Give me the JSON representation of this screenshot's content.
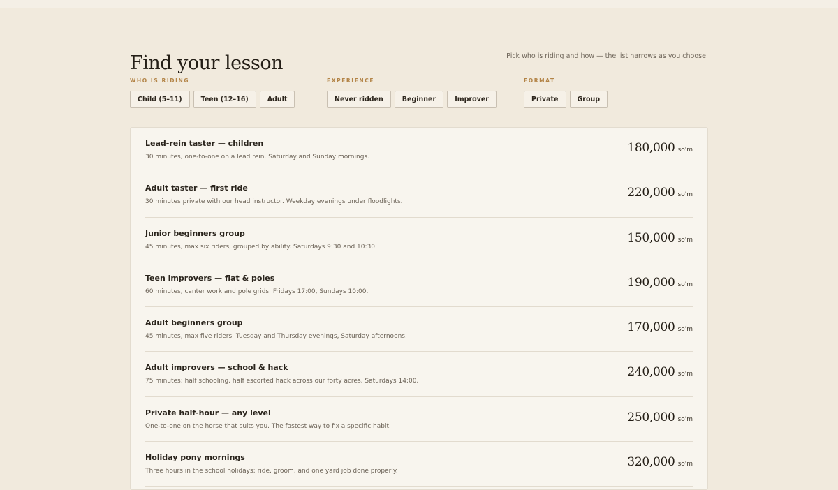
{
  "page": {
    "title": "Find your lesson",
    "hint": "Pick who is riding and how — the list narrows as you choose."
  },
  "filters": [
    {
      "label": "WHO IS RIDING",
      "options": [
        "Child (5–11)",
        "Teen (12–16)",
        "Adult"
      ]
    },
    {
      "label": "EXPERIENCE",
      "options": [
        "Never ridden",
        "Beginner",
        "Improver"
      ]
    },
    {
      "label": "FORMAT",
      "options": [
        "Private",
        "Group"
      ]
    }
  ],
  "lessons": [
    {
      "title": "Lead-rein taster — children",
      "desc": "30 minutes, one-to-one on a lead rein. Saturday and Sunday mornings.",
      "price": "180,000",
      "currency": "so'm"
    },
    {
      "title": "Adult taster — first ride",
      "desc": "30 minutes private with our head instructor. Weekday evenings under floodlights.",
      "price": "220,000",
      "currency": "so'm"
    },
    {
      "title": "Junior beginners group",
      "desc": "45 minutes, max six riders, grouped by ability. Saturdays 9:30 and 10:30.",
      "price": "150,000",
      "currency": "so'm"
    },
    {
      "title": "Teen improvers — flat & poles",
      "desc": "60 minutes, canter work and pole grids. Fridays 17:00, Sundays 10:00.",
      "price": "190,000",
      "currency": "so'm"
    },
    {
      "title": "Adult beginners group",
      "desc": "45 minutes, max five riders. Tuesday and Thursday evenings, Saturday afternoons.",
      "price": "170,000",
      "currency": "so'm"
    },
    {
      "title": "Adult improvers — school & hack",
      "desc": "75 minutes: half schooling, half escorted hack across our forty acres. Saturdays 14:00.",
      "price": "240,000",
      "currency": "so'm"
    },
    {
      "title": "Private half-hour — any level",
      "desc": "One-to-one on the horse that suits you. The fastest way to fix a specific habit.",
      "price": "250,000",
      "currency": "so'm"
    },
    {
      "title": "Holiday pony mornings",
      "desc": "Three hours in the school holidays: ride, groom, and one yard job done properly.",
      "price": "320,000",
      "currency": "so'm"
    }
  ]
}
